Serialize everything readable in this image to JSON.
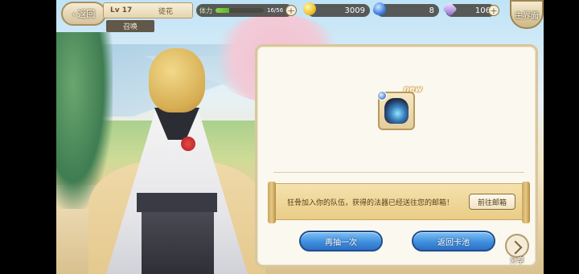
{
  "header": {
    "back_label": "返回",
    "level": "Lv 17",
    "player_name": "徒花",
    "mode_tab": "召唤",
    "home_label": "主界面"
  },
  "stamina": {
    "label": "体力",
    "value": "16/56",
    "fill_fraction": 0.2857
  },
  "resources": {
    "coins": "3009",
    "drops": "8",
    "crystals": "106"
  },
  "result": {
    "new_badge": "new",
    "item_icon": "blue-spirit-vessel-icon",
    "message": "狂骨加入你的队伍，获得的法器已经送往您的邮箱！",
    "mailbox_button": "前往邮箱",
    "draw_again_button": "再抽一次",
    "return_pool_button": "返回卡池",
    "share_label": "分享"
  },
  "colors": {
    "action_button": "#3f8fde",
    "panel_bg": "#fbf8ef",
    "scroll_bg": "#e9cc86"
  }
}
